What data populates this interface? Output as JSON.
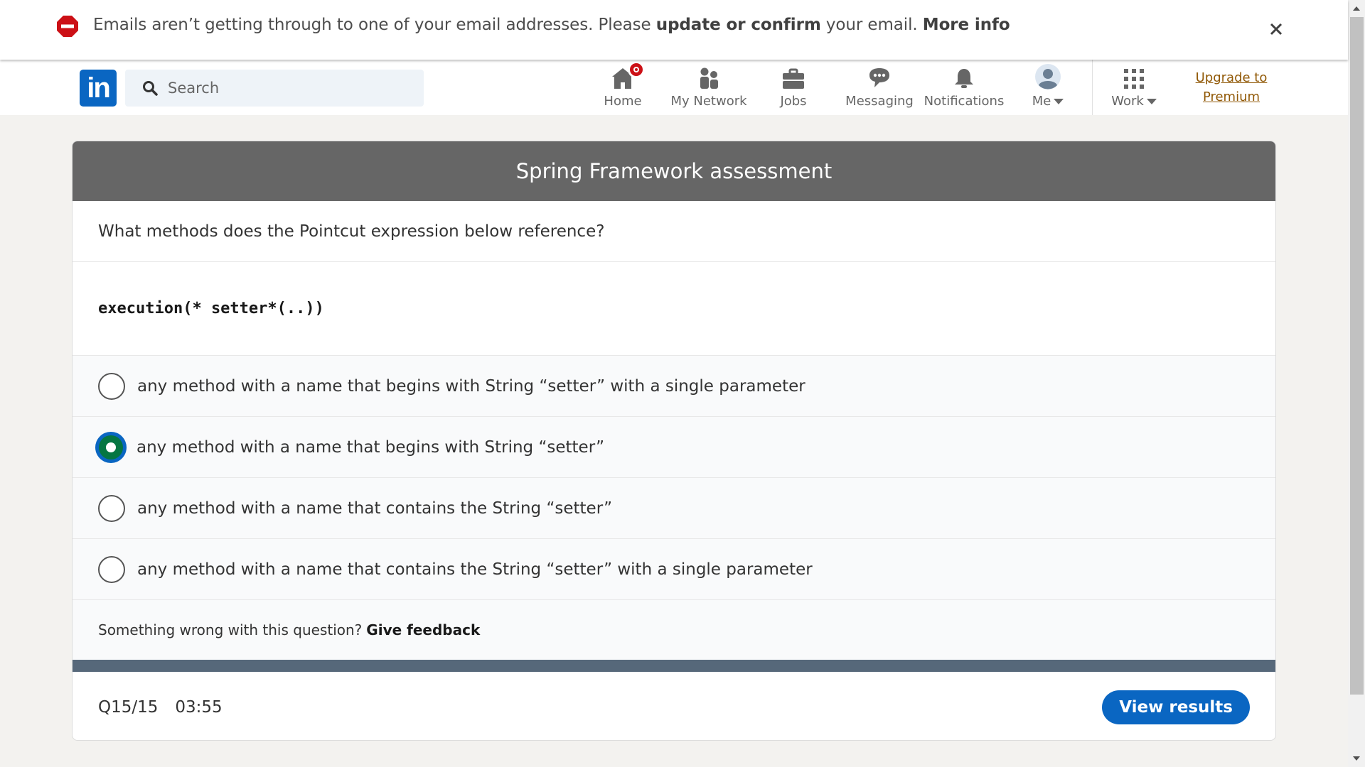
{
  "alert": {
    "prefix": "Emails aren’t getting through to one of your email addresses. Please ",
    "action": "update or confirm",
    "middle": " your email. ",
    "link": "More info",
    "icon": "stop-icon",
    "close_icon": "close-icon"
  },
  "nav": {
    "search_placeholder": "Search",
    "items": [
      {
        "label": "Home",
        "icon": "home-icon"
      },
      {
        "label": "My Network",
        "icon": "network-icon"
      },
      {
        "label": "Jobs",
        "icon": "briefcase-icon"
      },
      {
        "label": "Messaging",
        "icon": "messaging-icon"
      },
      {
        "label": "Notifications",
        "icon": "bell-icon"
      },
      {
        "label": "Me",
        "icon": "avatar-icon"
      },
      {
        "label": "Work",
        "icon": "grid-icon"
      }
    ],
    "premium_line1": "Upgrade to",
    "premium_line2": "Premium"
  },
  "assessment": {
    "title": "Spring Framework assessment",
    "question": "What methods does the Pointcut expression below reference?",
    "code": "execution(* setter*(..))",
    "options": [
      {
        "text": "any method with a name that begins with String “setter” with a single parameter",
        "selected": false
      },
      {
        "text": "any method with a name that begins with String “setter”",
        "selected": true
      },
      {
        "text": "any method with a name that contains the String “setter”",
        "selected": false
      },
      {
        "text": "any method with a name that contains the String “setter” with a single parameter",
        "selected": false
      }
    ],
    "feedback_prompt": "Something wrong with this question?",
    "feedback_link": "Give feedback",
    "question_number": "Q15/15",
    "timer": "03:55",
    "view_results": "View results"
  },
  "colors": {
    "brand_blue": "#0a66c2",
    "selected_green": "#057642",
    "header_gray": "#666666",
    "progress_bar": "#56687a",
    "alert_red": "#cc1016",
    "premium_link": "#915907"
  }
}
